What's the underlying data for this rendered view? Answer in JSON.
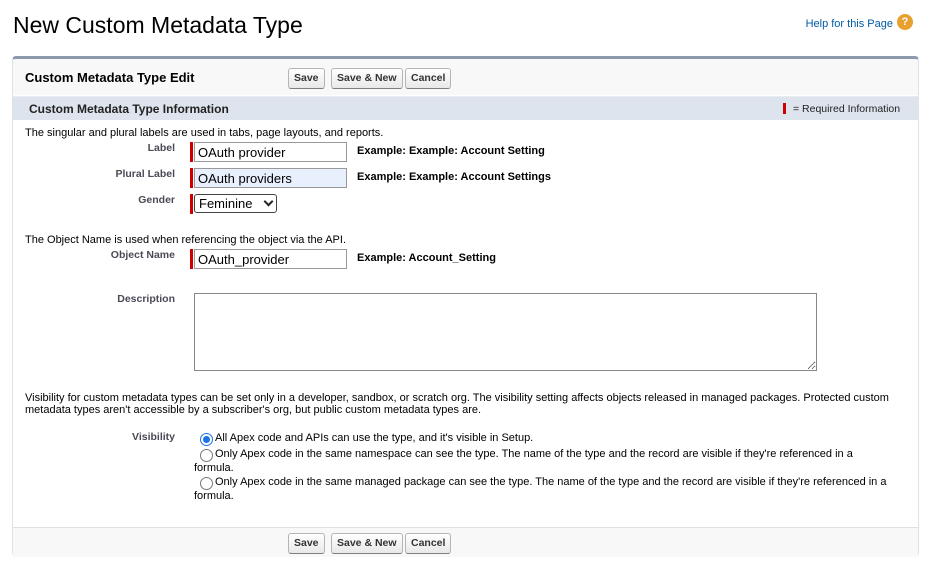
{
  "page": {
    "title": "New Custom Metadata Type",
    "help_link": "Help for this Page",
    "help_icon": "?"
  },
  "edit": {
    "title": "Custom Metadata Type Edit",
    "save_label": "Save",
    "save_new_label": "Save & New",
    "cancel_label": "Cancel"
  },
  "section": {
    "title": "Custom Metadata Type Information",
    "required_info": "= Required Information",
    "required_color": "#cc0000"
  },
  "labels_info": "The singular and plural labels are used in tabs, page layouts, and reports.",
  "fields": {
    "label": {
      "label": "Label",
      "value": "OAuth provider",
      "example": "Example:  Example: Account Setting"
    },
    "plural_label": {
      "label": "Plural Label",
      "value": "OAuth providers",
      "example": "Example:  Example: Account Settings"
    },
    "gender": {
      "label": "Gender",
      "value": "Feminine"
    },
    "object_name": {
      "label": "Object Name",
      "value": "OAuth_provider",
      "example": "Example:  Account_Setting"
    },
    "description": {
      "label": "Description",
      "value": ""
    }
  },
  "object_info": "The Object Name is used when referencing the object via the API.",
  "visibility_info": "Visibility for custom metadata types can be set only in a developer, sandbox, or scratch org. The visibility setting affects objects released in managed packages. Protected custom metadata types aren't accessible by a subscriber's org, but public custom metadata types are.",
  "visibility": {
    "label": "Visibility",
    "options": [
      {
        "text": "All Apex code and APIs can use the type, and it's visible in Setup.",
        "checked": true
      },
      {
        "text": "Only Apex code in the same namespace can see the type. The name of the type and the record are visible if they're referenced in a formula.",
        "checked": false
      },
      {
        "text": "Only Apex code in the same managed package can see the type. The name of the type and the record are visible if they're referenced in a formula.",
        "checked": false
      }
    ]
  },
  "colors": {
    "accent": "#1a73e8",
    "help_icon": "#e8a02f",
    "link": "#015ba7"
  }
}
